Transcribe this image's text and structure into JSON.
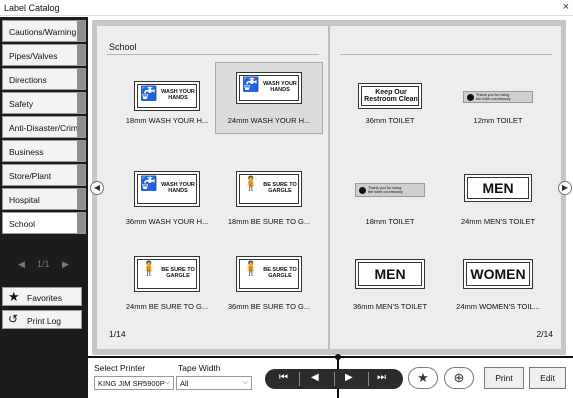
{
  "window": {
    "title": "Label Catalog",
    "close_glyph": "×"
  },
  "sidebar": {
    "categories": [
      {
        "label": "Cautions/Warning"
      },
      {
        "label": "Pipes/Valves"
      },
      {
        "label": "Directions"
      },
      {
        "label": "Safety"
      },
      {
        "label": "Anti-Disaster/Crime"
      },
      {
        "label": "Business"
      },
      {
        "label": "Store/Plant"
      },
      {
        "label": "Hospital"
      },
      {
        "label": "School"
      }
    ],
    "selected": "School",
    "pager": {
      "prev": "◀",
      "text": "1/1",
      "next": "▶"
    },
    "favorites_label": "Favorites",
    "printlog_label": "Print Log"
  },
  "book": {
    "page_title": "School",
    "left_page_number": "1/14",
    "right_page_number": "2/14",
    "prev_arrow": "◀",
    "next_arrow": "▶",
    "left_items": [
      {
        "caption": "18mm WASH YOUR H...",
        "label_text": "WASH YOUR\nHANDS",
        "icon": "faucet-icon"
      },
      {
        "caption": "24mm WASH YOUR H...",
        "label_text": "WASH YOUR\nHANDS",
        "icon": "faucet-icon"
      },
      {
        "caption": "36mm WASH YOUR H...",
        "label_text": "WASH YOUR\nHANDS",
        "icon": "faucet-icon"
      },
      {
        "caption": "18mm BE SURE TO G...",
        "label_text": "BE SURE TO\nGARGLE",
        "icon": "gargle-icon"
      },
      {
        "caption": "24mm BE SURE TO G...",
        "label_text": "BE SURE TO\nGARGLE",
        "icon": "gargle-icon"
      },
      {
        "caption": "36mm BE SURE TO G...",
        "label_text": "BE SURE TO\nGARGLE",
        "icon": "gargle-icon"
      }
    ],
    "right_items": [
      {
        "caption": "36mm TOILET",
        "label_text": "Keep Our\nRestroom Clean"
      },
      {
        "caption": "12mm TOILET",
        "label_text": "Thank you for using\nthe toilet courteously"
      },
      {
        "caption": "18mm TOILET",
        "label_text": "Thank you for using\nthe toilet courteously"
      },
      {
        "caption": "24mm MEN'S TOILET",
        "label_text": "MEN"
      },
      {
        "caption": "36mm MEN'S TOILET",
        "label_text": "MEN"
      },
      {
        "caption": "24mm WOMEN'S TOIL...",
        "label_text": "WOMEN"
      }
    ],
    "selected_item": "24mm WASH YOUR H..."
  },
  "toolbar": {
    "printer_label": "Select Printer",
    "printer_value": "KING JIM SR5900P",
    "tape_label": "Tape Width",
    "tape_value": "All",
    "nav_first": "⏮",
    "nav_prev": "◀",
    "nav_next": "▶",
    "nav_last": "⏭",
    "favorite_glyph": "★",
    "zoom_glyph": "⊕",
    "print_label": "Print",
    "edit_label": "Edit"
  }
}
